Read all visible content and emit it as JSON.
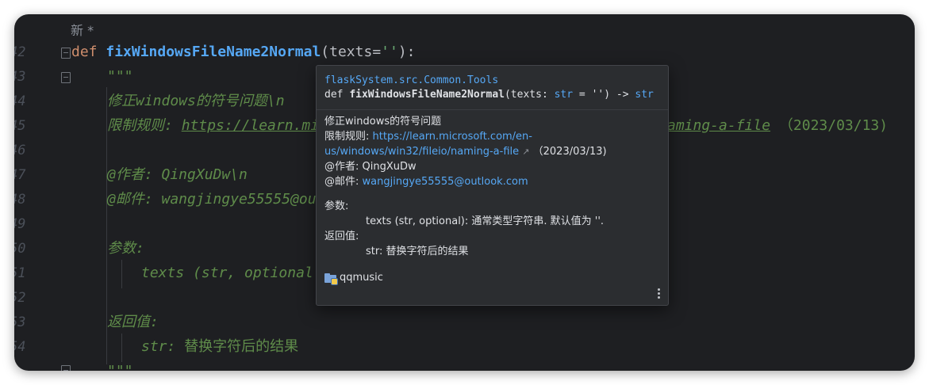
{
  "editor": {
    "new_hint": "新 *",
    "line_numbers": [
      "42",
      "43",
      "44",
      "45",
      "46",
      "47",
      "48",
      "49",
      "50",
      "51",
      "52",
      "53",
      "54"
    ],
    "code": {
      "l42": {
        "kw": "def",
        "fn": "fixWindowsFileName2Normal",
        "open": "(texts=",
        "str": "''",
        "close": "):"
      },
      "l43": "\"\"\"",
      "l44": "修正windows的符号问题\\n",
      "l45_prefix": "限制规则: ",
      "l45_link_start": "https://learn.mi",
      "l45_link_end": "aming-a-file",
      "l45_suffix": "（2023/03/13)",
      "l47": "@作者: QingXuDw\\n",
      "l48": "@邮件: wangjingye55555@ou",
      "l50": "参数:",
      "l51": "texts (str, optional",
      "l53": "返回值:",
      "l54_a": "str: ",
      "l54_b": "替换字符后的结果",
      "l55": "\"\"\""
    }
  },
  "popup": {
    "module": "flaskSystem.src.Common.Tools",
    "signature": {
      "def": "def ",
      "name": "fixWindowsFileName2Normal",
      "params_open": "(texts: ",
      "type1": "str",
      "params_rest": " = '') -> ",
      "type2": "str"
    },
    "summary": "修正windows的符号问题",
    "rule_label": "限制规则: ",
    "rule_link_1": "https://learn.microsoft.com/en-",
    "rule_link_2": "us/windows/win32/fileio/naming-a-file",
    "external_icon": "↗",
    "rule_date": " （2023/03/13)",
    "author": "@作者: QingXuDw",
    "email_label": "@邮件: ",
    "email": "wangjingye55555@outlook.com",
    "params_label": "参数:",
    "param_desc": "texts (str, optional): 通常类型字符串. 默认值为 ''.",
    "returns_label": "返回值:",
    "returns_desc": "str: 替换字符后的结果",
    "package": "qqmusic"
  }
}
